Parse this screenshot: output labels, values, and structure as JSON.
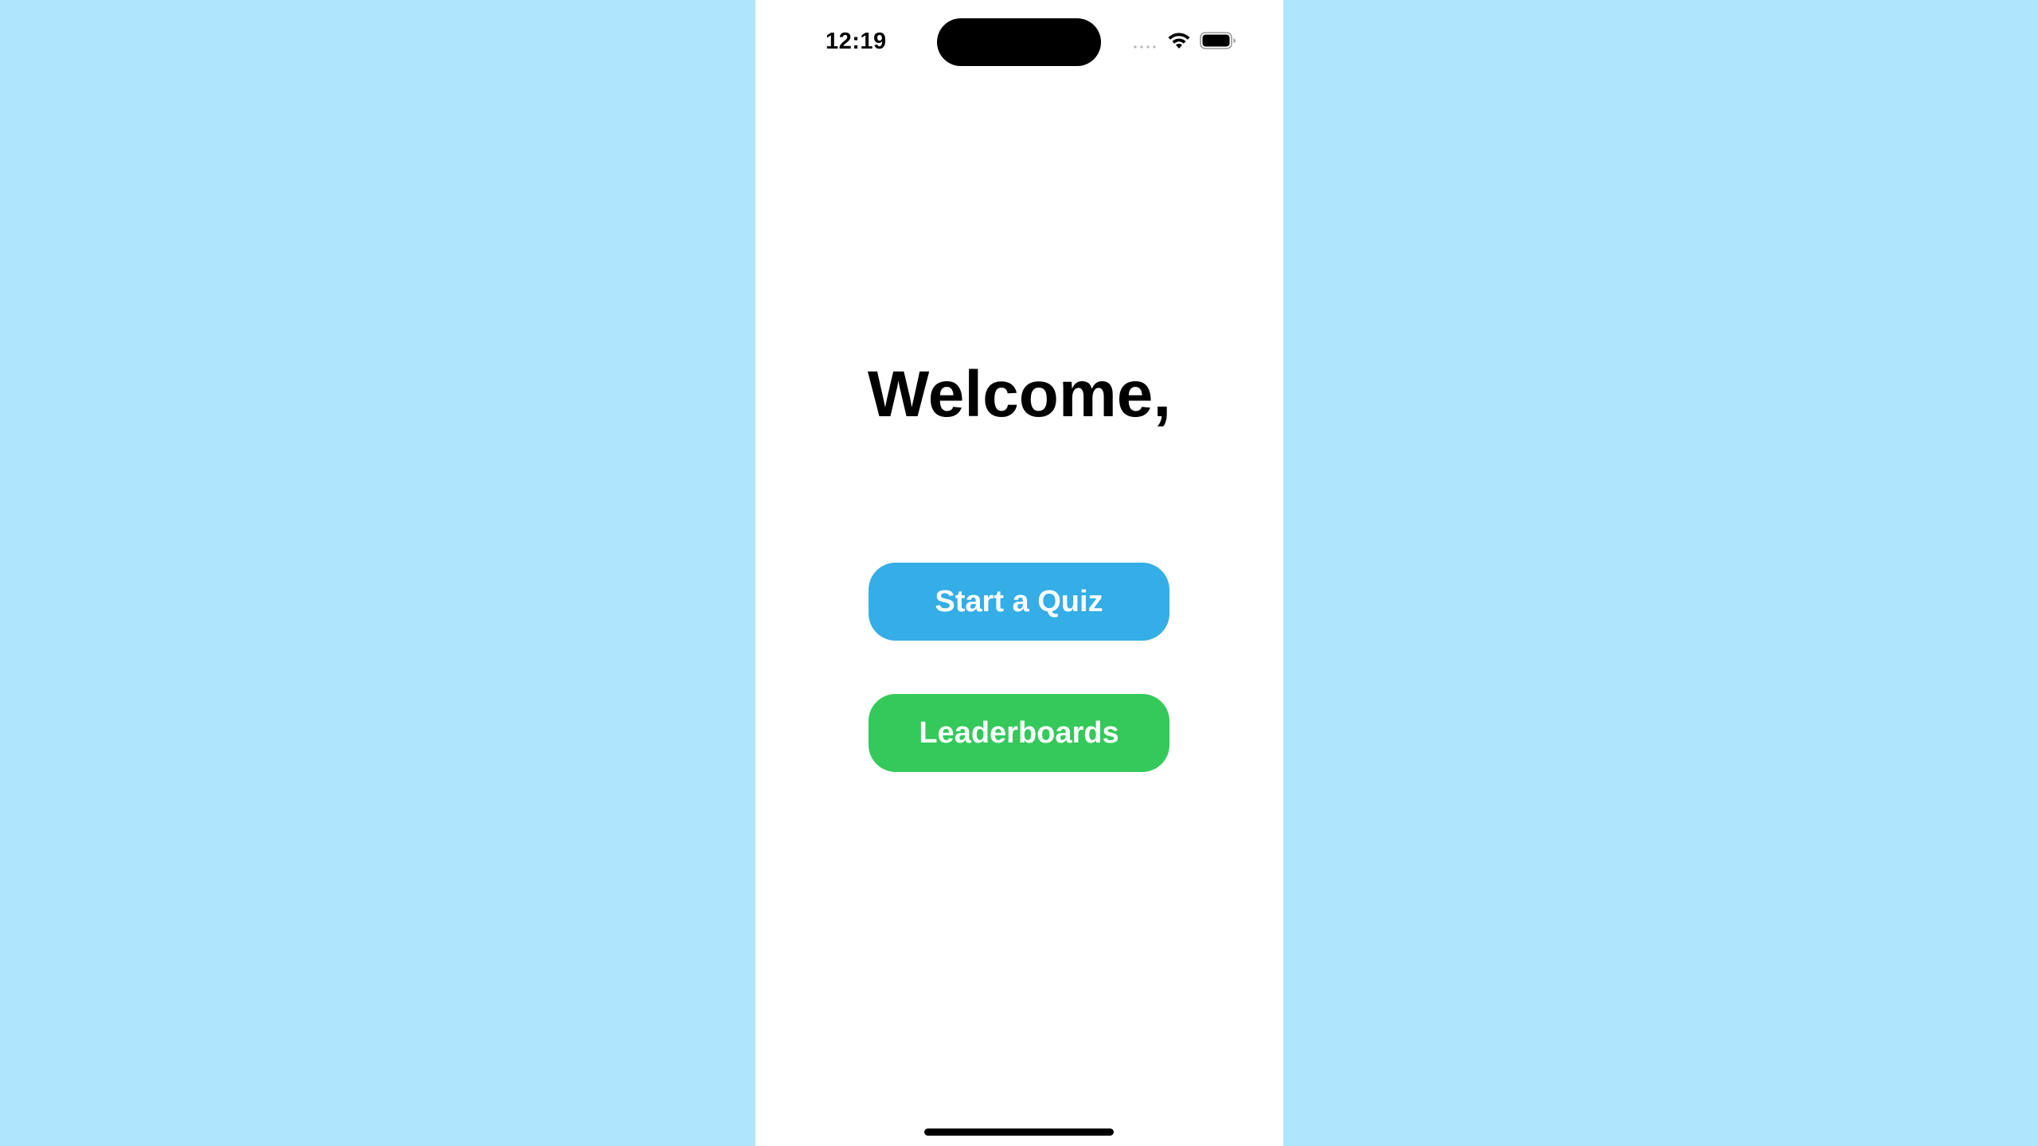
{
  "status_bar": {
    "time": "12:19",
    "icons": [
      "cellular-signal-icon",
      "wifi-icon",
      "battery-icon"
    ]
  },
  "main": {
    "title": "Welcome,",
    "buttons": [
      {
        "label": "Start a Quiz",
        "color": "#35ade6"
      },
      {
        "label": "Leaderboards",
        "color": "#34c95a"
      }
    ]
  },
  "colors": {
    "background": "#b0e6fd",
    "screen": "#ffffff",
    "text": "#000000"
  }
}
